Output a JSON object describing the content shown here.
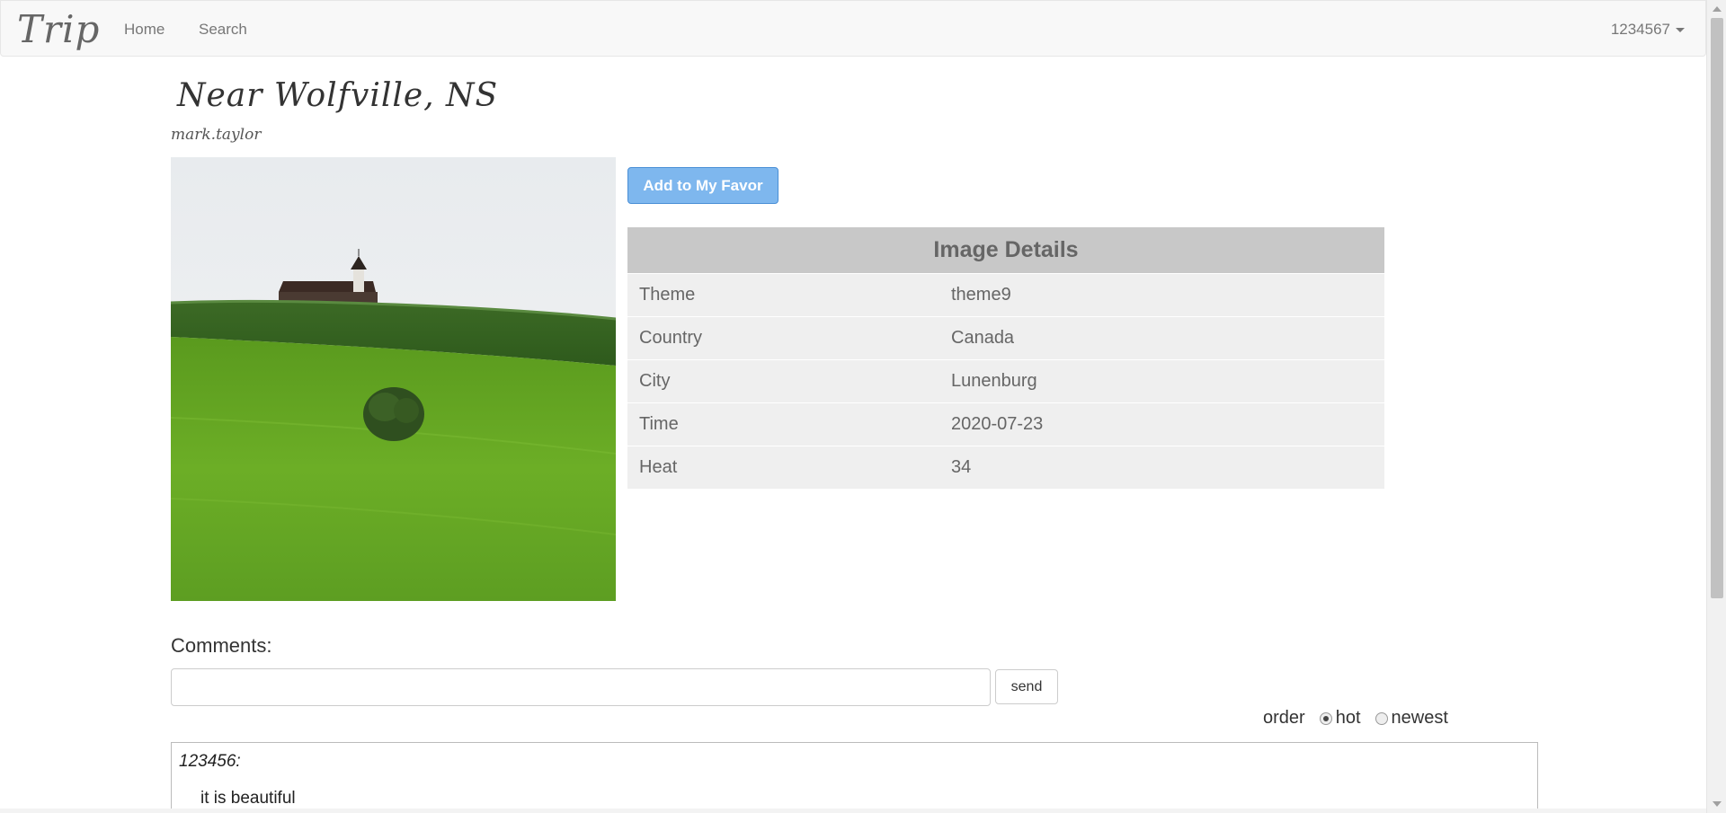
{
  "navbar": {
    "brand": "Trip",
    "home_label": "Home",
    "search_label": "Search",
    "user_label": "1234567"
  },
  "photo": {
    "title": "Near Wolfville, NS",
    "author": "mark.taylor"
  },
  "favor_button": "Add to My Favor",
  "details": {
    "heading": "Image Details",
    "rows": [
      {
        "key": "Theme",
        "value": "theme9"
      },
      {
        "key": "Country",
        "value": "Canada"
      },
      {
        "key": "City",
        "value": "Lunenburg"
      },
      {
        "key": "Time",
        "value": "2020-07-23"
      },
      {
        "key": "Heat",
        "value": "34"
      }
    ]
  },
  "comments": {
    "label": "Comments:",
    "input_value": "",
    "send_label": "send",
    "order_label": "order",
    "order_options": [
      "hot",
      "newest"
    ],
    "order_selected": "hot",
    "items": [
      {
        "user": "123456:",
        "text": "it is beautiful"
      }
    ]
  },
  "colors": {
    "favor_button_bg": "#7eb7ee",
    "details_header_bg": "#c8c8c8",
    "details_row_bg": "#efefef"
  }
}
